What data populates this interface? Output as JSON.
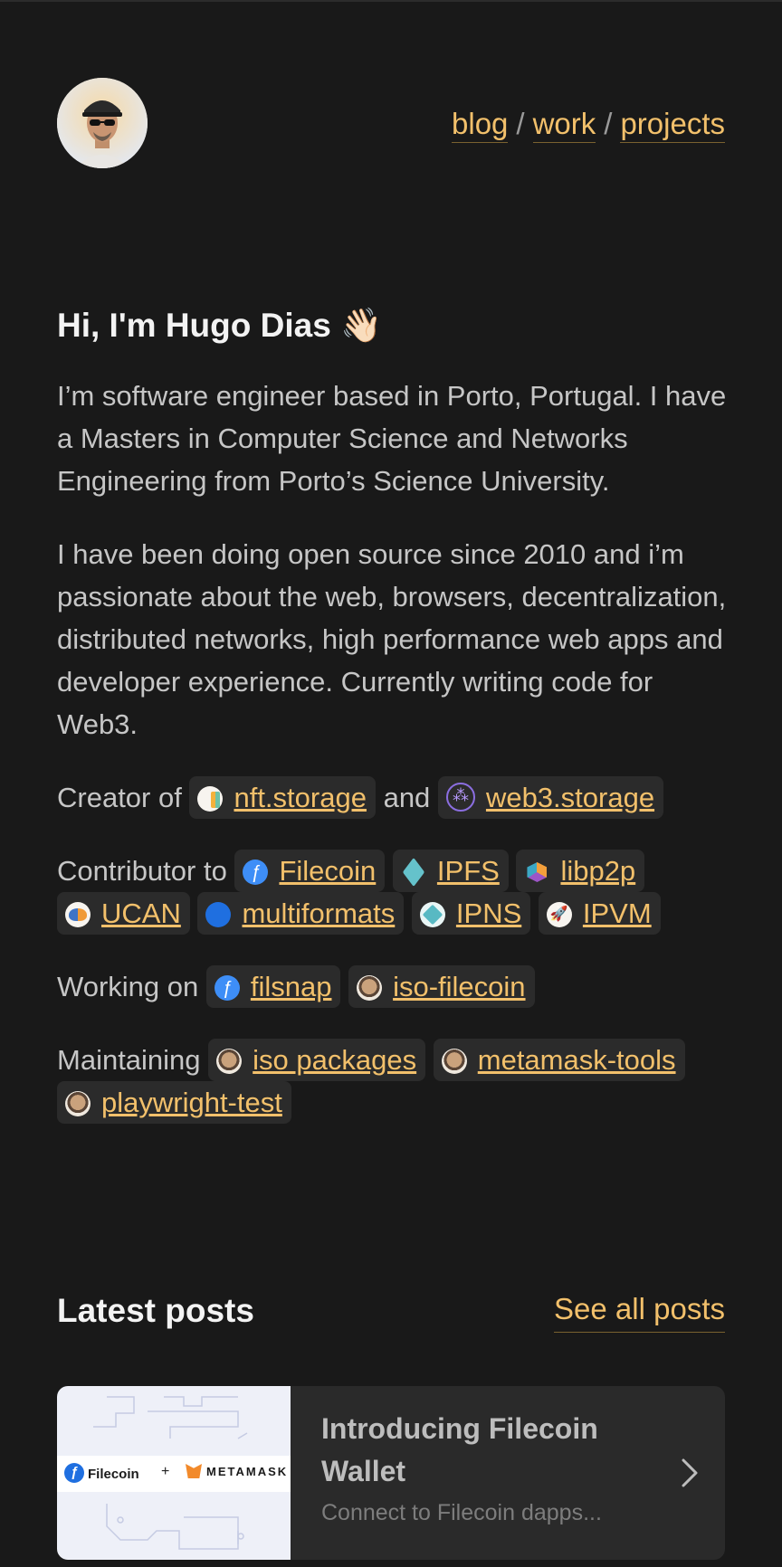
{
  "header": {
    "nav": [
      {
        "label": "blog"
      },
      {
        "label": "work"
      },
      {
        "label": "projects"
      }
    ],
    "separator": "/"
  },
  "intro": {
    "greeting": "Hi, I'm Hugo Dias 👋🏻",
    "para1": "I’m software engineer based in Porto, Portugal. I have a Masters in Computer Science and Networks Engineering from Porto’s Science University.",
    "para2": "I have been doing open source since 2010 and i’m passionate about the web, browsers, decentralization, distributed networks, high performance web apps and developer experience. Currently writing code for Web3.",
    "creator_label": "Creator of",
    "and_label": "and",
    "creator": [
      {
        "label": "nft.storage",
        "icon": "nft-storage-icon"
      },
      {
        "label": "web3.storage",
        "icon": "web3-storage-icon"
      }
    ],
    "contributor_label": "Contributor to",
    "contributor": [
      {
        "label": "Filecoin",
        "icon": "filecoin-icon"
      },
      {
        "label": "IPFS",
        "icon": "ipfs-icon"
      },
      {
        "label": "libp2p",
        "icon": "libp2p-icon"
      },
      {
        "label": "UCAN",
        "icon": "ucan-icon"
      },
      {
        "label": "multiformats",
        "icon": "multiformats-icon"
      },
      {
        "label": "IPNS",
        "icon": "ipns-icon"
      },
      {
        "label": "IPVM",
        "icon": "ipvm-icon"
      }
    ],
    "working_label": "Working on",
    "working": [
      {
        "label": "filsnap",
        "icon": "filecoin-icon"
      },
      {
        "label": "iso-filecoin",
        "icon": "avatar-icon"
      }
    ],
    "maintaining_label": "Maintaining",
    "maintaining": [
      {
        "label": "iso packages",
        "icon": "avatar-icon"
      },
      {
        "label": "metamask-tools",
        "icon": "avatar-icon"
      },
      {
        "label": "playwright-test",
        "icon": "avatar-icon"
      }
    ]
  },
  "posts": {
    "title": "Latest posts",
    "see_all": "See all posts",
    "items": [
      {
        "title": "Introducing Filecoin Wallet",
        "description": "Connect to Filecoin dapps...",
        "thumb_left": "Filecoin",
        "thumb_plus": "+",
        "thumb_right": "METAMASK"
      }
    ]
  },
  "colors": {
    "background": "#191919",
    "accent": "#f2c06b",
    "chip_bg": "#2b2b2b"
  }
}
